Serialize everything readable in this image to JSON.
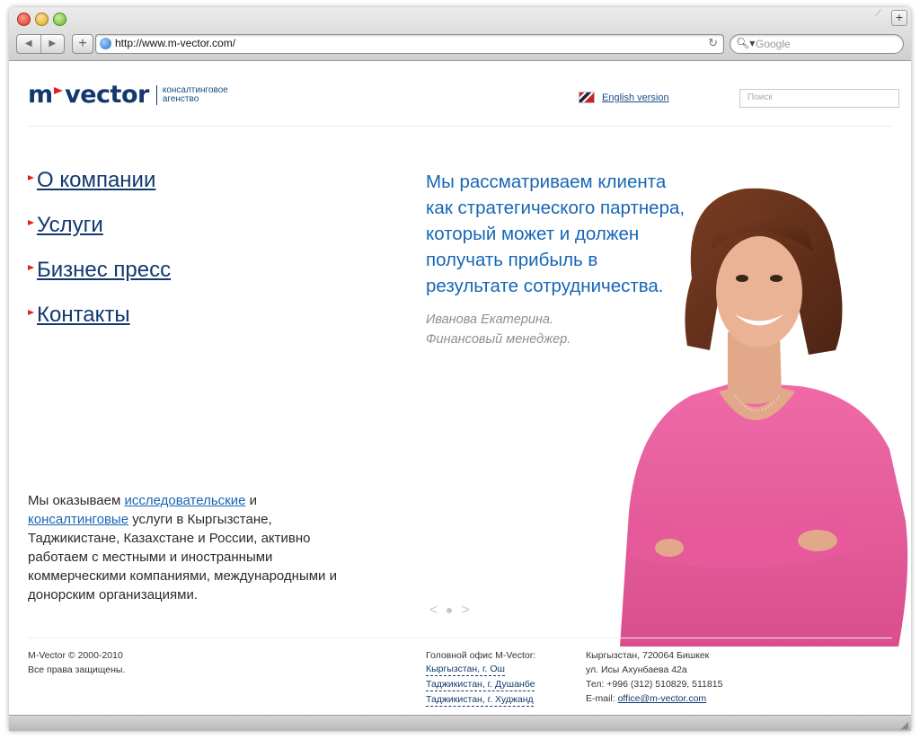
{
  "browser": {
    "url": "http://www.m-vector.com/",
    "search_placeholder": "Google",
    "new_tab": "+",
    "add_bookmark": "+",
    "back": "◀",
    "forward": "▶",
    "reload": "↻"
  },
  "header": {
    "logo_m": "m",
    "logo_vector": "vector",
    "tagline": "консалтинговое агенство",
    "english_link": "English version",
    "search_placeholder": "Поиск"
  },
  "menu": {
    "items": [
      {
        "label": "О компании"
      },
      {
        "label": "Услуги"
      },
      {
        "label": "Бизнес пресс"
      },
      {
        "label": "Контакты"
      }
    ]
  },
  "hero": {
    "quote": "Мы рассматриваем клиента как стратегического партнера, который может и должен получать прибыль в результате сотрудничества.",
    "author_name": "Иванова Екатерина.",
    "author_title": "Финансовый менеджер.",
    "slider_prev": "<",
    "slider_next": ">"
  },
  "intro": {
    "text_1": "Мы оказываем ",
    "link_1": "исследовательские",
    "text_2": " и ",
    "link_2": "консалтинговые",
    "text_3": " услуги в Кыргызстане, Таджикистане, Казахстане и России, активно работаем с местными и иностранными коммерческими компаниями, международными и донорским организациями."
  },
  "footer": {
    "copyright": "M-Vector © 2000-2010",
    "rights": "Все права защищены.",
    "head_office": "Головной офис M-Vector:",
    "offices": [
      {
        "label": "Кыргызстан, г. Ош"
      },
      {
        "label": "Таджикистан, г. Душанбе"
      },
      {
        "label": "Таджикистан, г. Худжанд"
      }
    ],
    "address_line1": "Кыргызстан, 720064 Бишкек",
    "address_line2": "ул. Исы Ахунбаева 42а",
    "phone": "Тел: +996 (312) 510829, 511815",
    "email_label": "E-mail: ",
    "email": "office@m-vector.com"
  },
  "colors": {
    "brand_navy": "#12386e",
    "brand_red": "#e2231a",
    "quote_blue": "#1766b5",
    "cardigan_pink": "#e8569a"
  }
}
